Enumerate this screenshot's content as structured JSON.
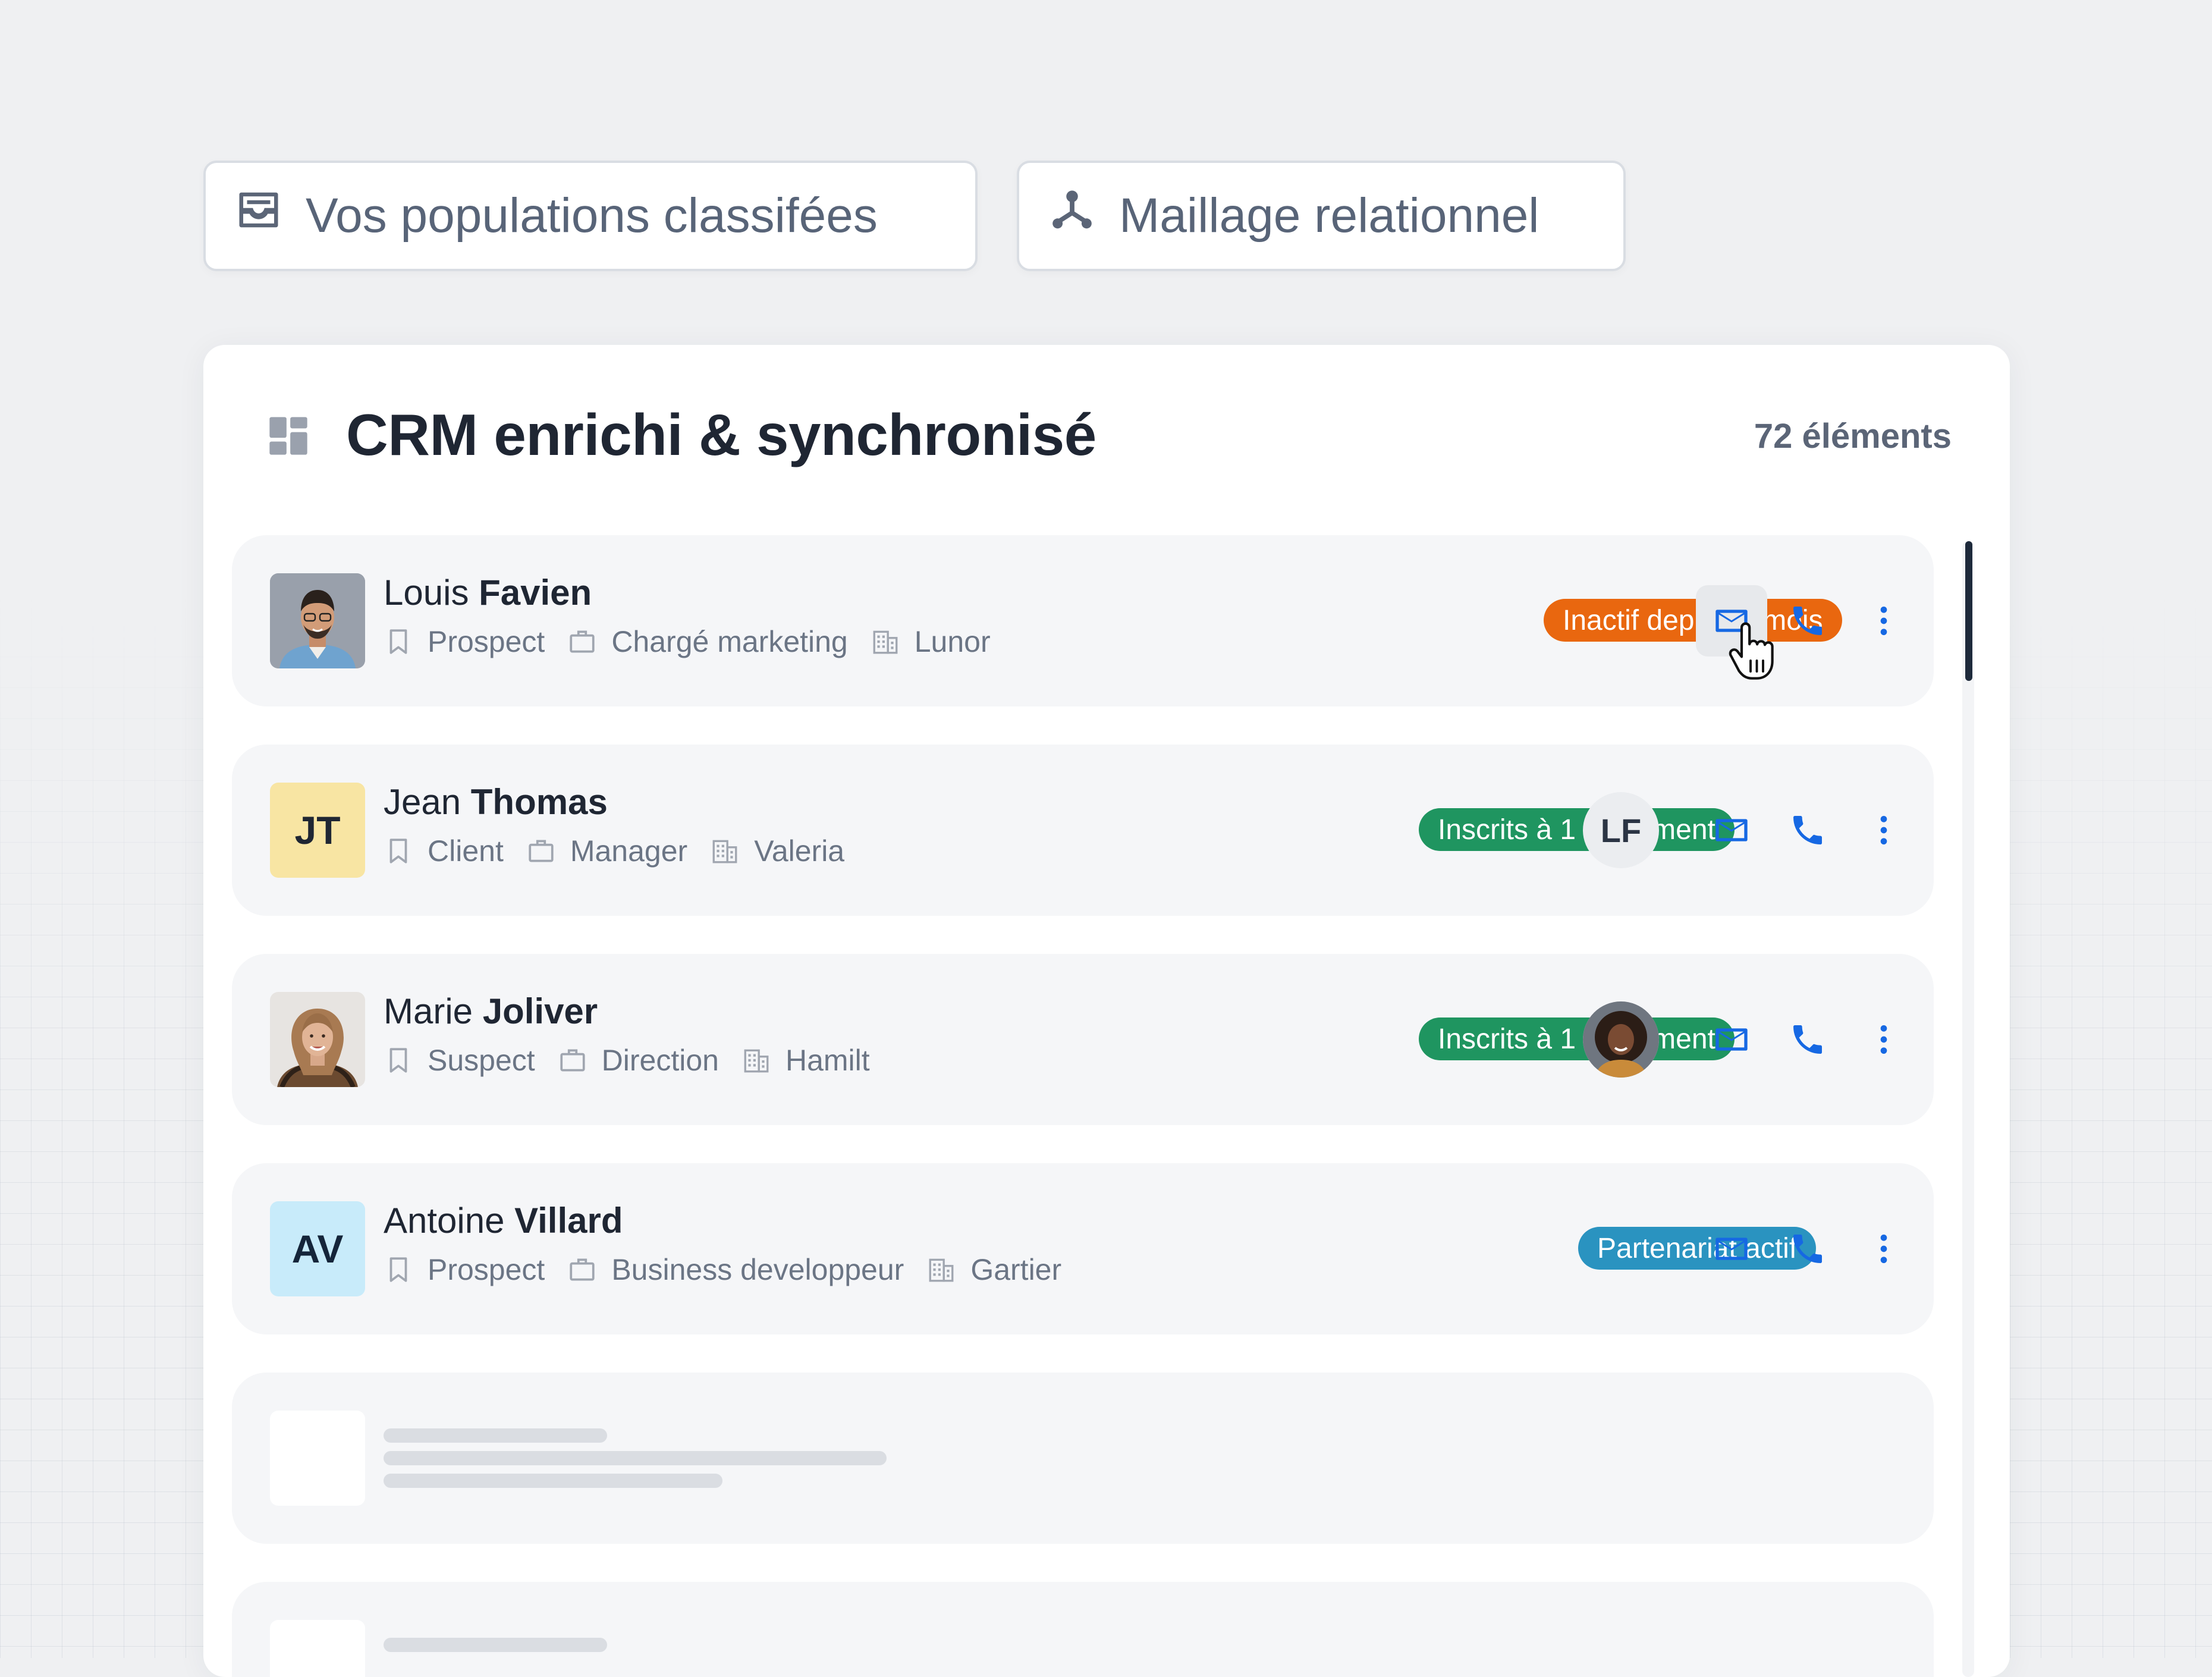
{
  "tabs": [
    {
      "label": "Vos populations classifées",
      "icon": "inbox-icon"
    },
    {
      "label": "Maillage relationnel",
      "icon": "network-icon"
    }
  ],
  "card": {
    "title": "CRM enrichi & synchronisé",
    "count": "72 éléments",
    "icon": "dashboard-icon"
  },
  "contacts": [
    {
      "first_name": "Louis",
      "last_name": "Favien",
      "avatar": "photo",
      "status": "Prospect",
      "role": "Chargé marketing",
      "company": "Lunor",
      "badge": "Inactif depuis 2 mois",
      "badge_color": "#e9670f",
      "owner": null
    },
    {
      "first_name": "Jean",
      "last_name": "Thomas",
      "avatar_initials": "JT",
      "status": "Client",
      "role": "Manager",
      "company": "Valeria",
      "badge": "Inscrits à 1 lancement",
      "badge_color": "#1f9560",
      "owner_initials": "LF"
    },
    {
      "first_name": "Marie",
      "last_name": "Joliver",
      "avatar": "photo",
      "status": "Suspect",
      "role": "Direction",
      "company": "Hamilt",
      "badge": "Inscrits à 1 lancement",
      "badge_color": "#1f9560",
      "owner": "photo"
    },
    {
      "first_name": "Antoine",
      "last_name": "Villard",
      "avatar_initials": "AV",
      "status": "Prospect",
      "role": "Business developpeur",
      "company": "Gartier",
      "badge": "Partenariat actif",
      "badge_color": "#2a93c0",
      "owner": null
    }
  ],
  "actions": {
    "mail_icon": "mail-icon",
    "phone_icon": "phone-icon",
    "more_icon": "more-vertical-icon",
    "accent": "#1668e3"
  }
}
